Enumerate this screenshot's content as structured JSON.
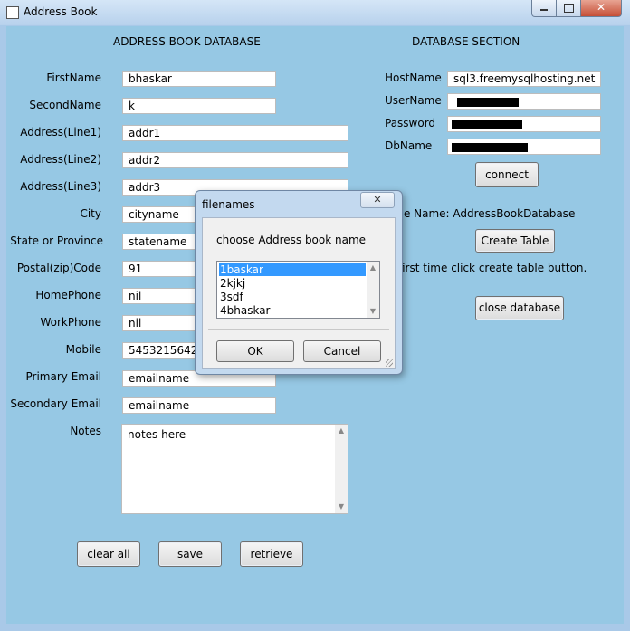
{
  "window": {
    "title": "Address Book"
  },
  "left_section": {
    "title": "ADDRESS BOOK DATABASE"
  },
  "right_section": {
    "title": "DATABASE SECTION"
  },
  "fields": {
    "first_name": {
      "label": "FirstName",
      "value": "bhaskar"
    },
    "second_name": {
      "label": "SecondName",
      "value": "k"
    },
    "address1": {
      "label": "Address(Line1)",
      "value": "addr1"
    },
    "address2": {
      "label": "Address(Line2)",
      "value": "addr2"
    },
    "address3": {
      "label": "Address(Line3)",
      "value": "addr3"
    },
    "city": {
      "label": "City",
      "value": "cityname"
    },
    "state": {
      "label": "State or Province",
      "value": "statename"
    },
    "postal": {
      "label": "Postal(zip)Code",
      "value": "91"
    },
    "home_phone": {
      "label": "HomePhone",
      "value": "nil"
    },
    "work_phone": {
      "label": "WorkPhone",
      "value": "nil"
    },
    "mobile": {
      "label": "Mobile",
      "value": "54532156423"
    },
    "primary_email": {
      "label": "Primary Email",
      "value": "emailname"
    },
    "secondary_email": {
      "label": "Secondary Email",
      "value": "emailname"
    },
    "notes": {
      "label": "Notes",
      "value": "notes here"
    }
  },
  "db": {
    "host": {
      "label": "HostName",
      "value": "sql3.freemysqlhosting.net"
    },
    "user": {
      "label": "UserName"
    },
    "password": {
      "label": "Password"
    },
    "dbname": {
      "label": "DbName"
    },
    "connect_label": "connect",
    "table_name_label": "ble Name: AddressBookDatabase",
    "create_table_label": "Create Table",
    "hint": "first time click create table button.",
    "close_db_label": "close database"
  },
  "actions": {
    "clear_all": "clear all",
    "save": "save",
    "retrieve": "retrieve"
  },
  "dialog": {
    "title": "filenames",
    "close_glyph": "✕",
    "prompt": "choose Address book name",
    "items": [
      "1baskar",
      "2kjkj",
      "3sdf",
      "4bhaskar"
    ],
    "selected_index": 0,
    "ok": "OK",
    "cancel": "Cancel"
  },
  "icons": {
    "min": "minimize-icon",
    "max": "maximize-icon",
    "close": "close-icon",
    "scroll_up": "▲",
    "scroll_down": "▼"
  }
}
